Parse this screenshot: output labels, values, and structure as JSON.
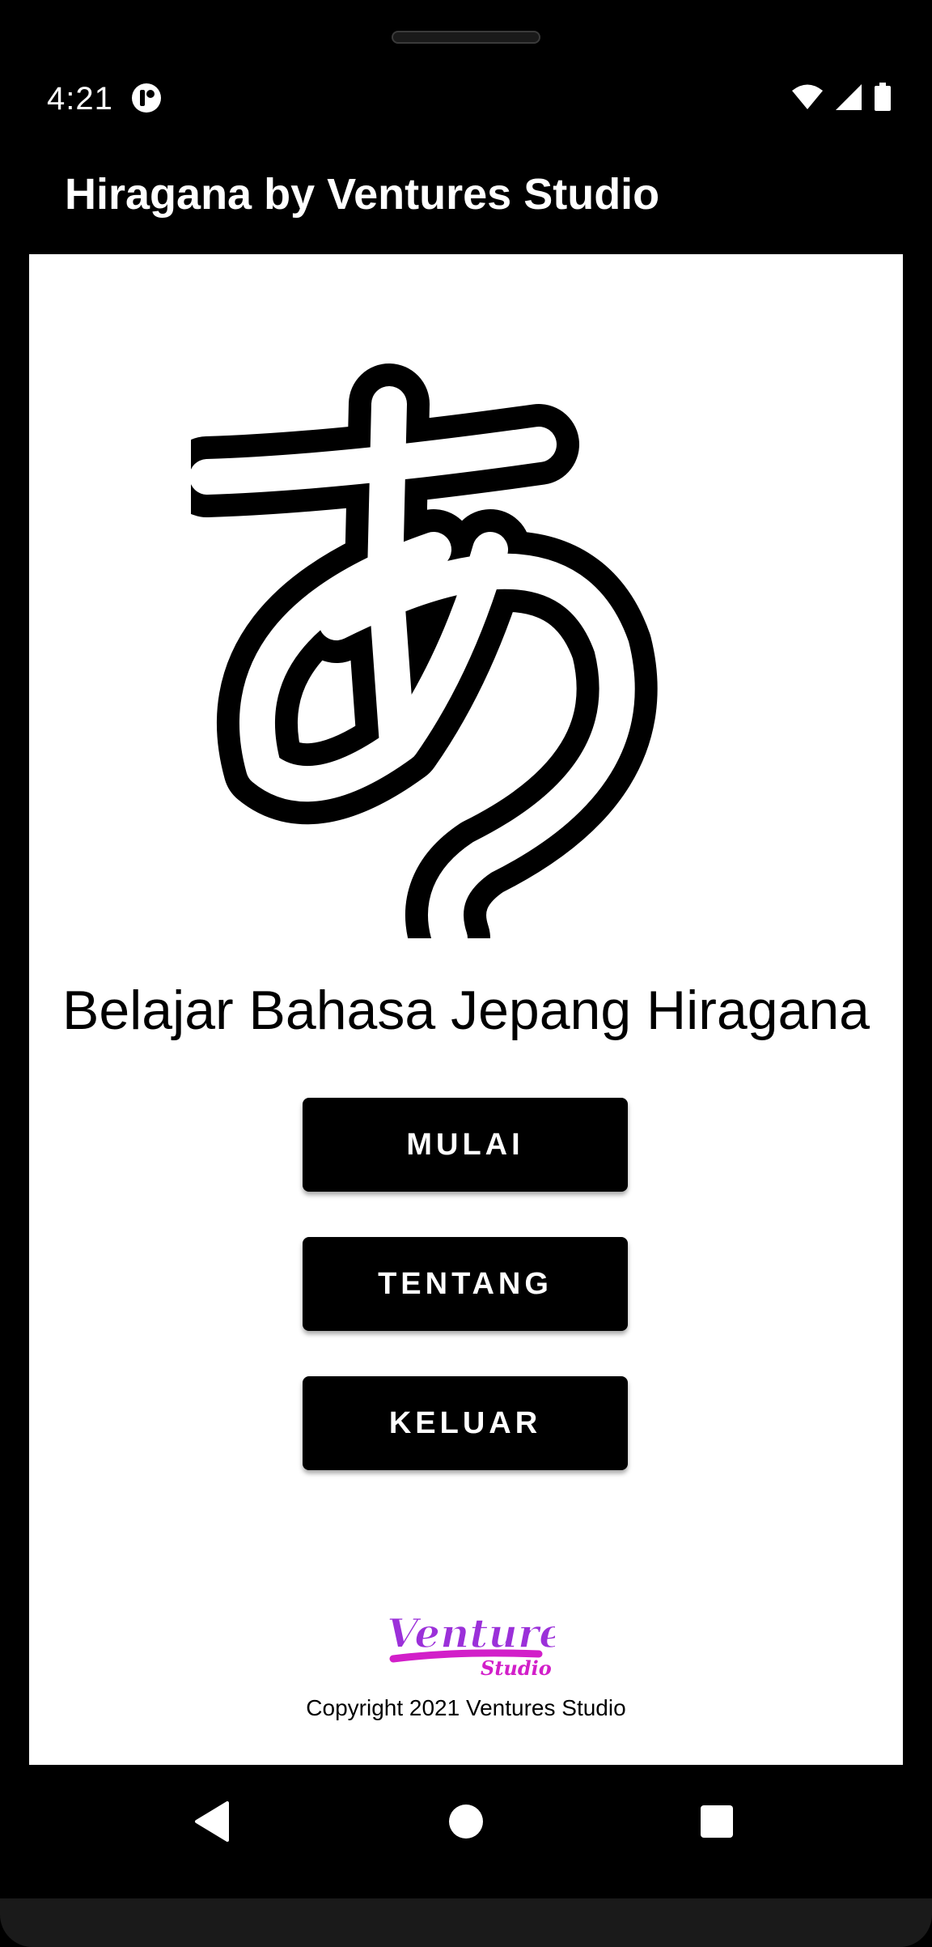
{
  "status_bar": {
    "time": "4:21",
    "icons": [
      "app-notification-icon",
      "wifi-icon",
      "cellular-signal-icon",
      "battery-icon"
    ]
  },
  "app_bar": {
    "title": "Hiragana by Ventures Studio"
  },
  "main": {
    "hero_icon": "hiragana-a-icon",
    "headline": "Belajar Bahasa Jepang Hiragana",
    "buttons": [
      {
        "label": "MULAI"
      },
      {
        "label": "TENTANG"
      },
      {
        "label": "KELUAR"
      }
    ],
    "footer": {
      "logo_text_primary": "Ventures",
      "logo_text_secondary": "Studio",
      "copyright": "Copyright 2021 Ventures Studio"
    }
  },
  "nav_bar": {
    "icons": [
      "back-icon",
      "home-icon",
      "recents-icon"
    ]
  },
  "colors": {
    "background": "#000000",
    "content": "#ffffff",
    "button": "#000000",
    "button_text": "#ffffff",
    "logo_purple": "#9b30d9",
    "logo_magenta": "#d21fc9"
  }
}
